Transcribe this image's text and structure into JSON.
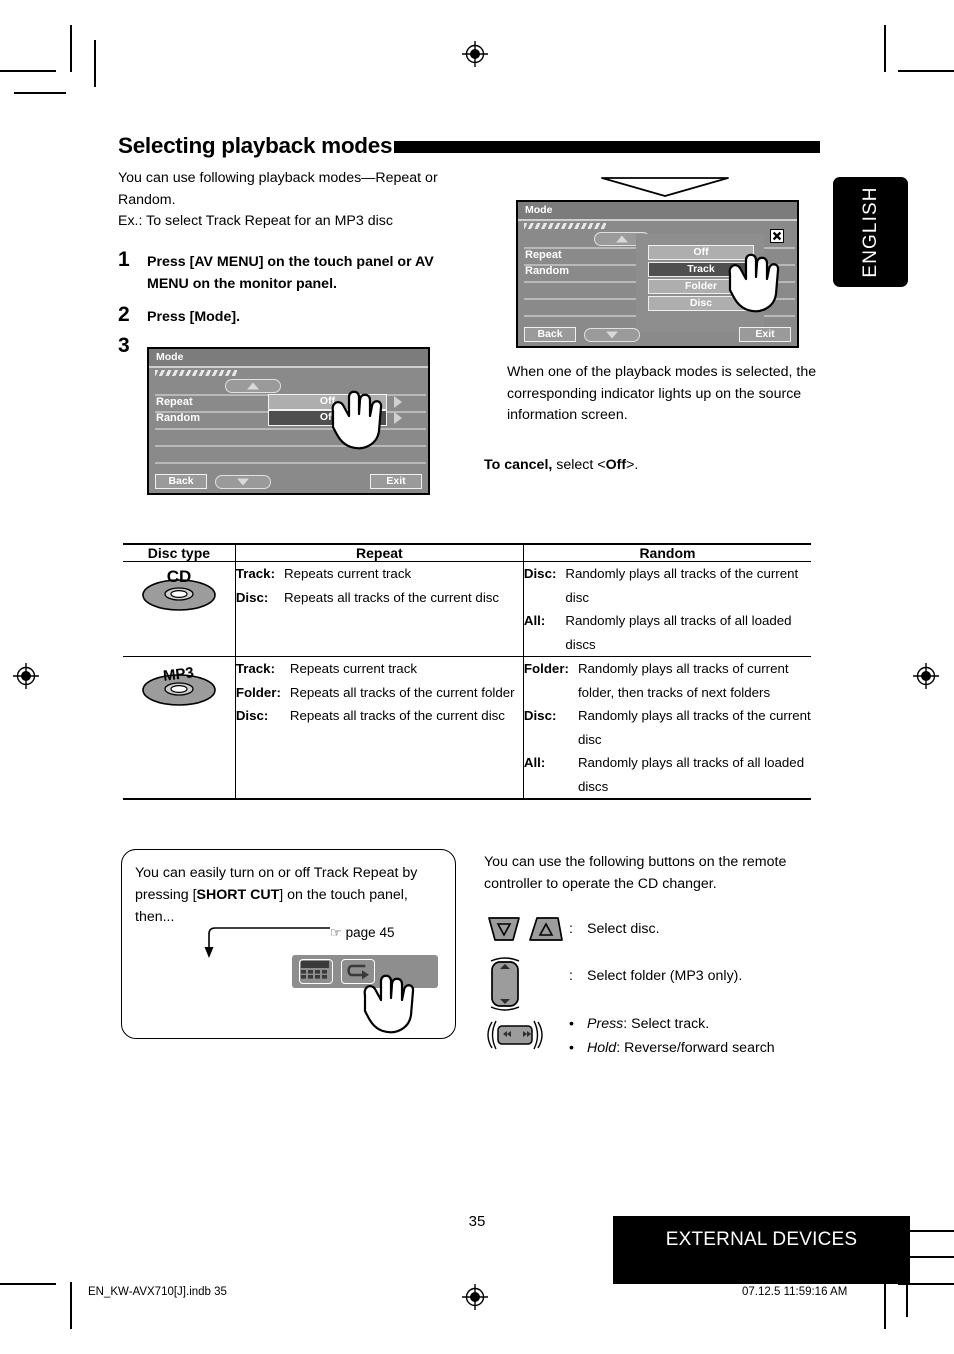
{
  "header": {
    "title": "Selecting playback modes"
  },
  "intro": {
    "line1": "You can use following playback modes—Repeat or",
    "line2": "Random.",
    "line3": "Ex.: To select Track Repeat for an MP3 disc"
  },
  "steps": [
    {
      "num": "1",
      "text": "Press [AV MENU] on the touch panel or AV MENU on the monitor panel."
    },
    {
      "num": "2",
      "text": "Press [Mode]."
    },
    {
      "num": "3",
      "text": ""
    }
  ],
  "screen_step3": {
    "title": "Mode",
    "rows": [
      {
        "label": "Repeat",
        "value": "Off",
        "highlight": "light"
      },
      {
        "label": "Random",
        "value": "Off",
        "highlight": "dark"
      }
    ],
    "back_label": "Back",
    "exit_label": "Exit"
  },
  "screen_popup": {
    "title": "Mode",
    "rows": [
      {
        "label": "Repeat"
      },
      {
        "label": "Random"
      }
    ],
    "popup_options": [
      {
        "label": "Off",
        "state": "normal"
      },
      {
        "label": "Track",
        "state": "selected"
      },
      {
        "label": "Folder",
        "state": "normal"
      },
      {
        "label": "Disc",
        "state": "normal"
      }
    ],
    "back_label": "Back",
    "exit_label": "Exit",
    "close_icon": "close-icon"
  },
  "right_notes": {
    "note": "When one of the playback modes is selected, the corresponding indicator lights up on the source information screen.",
    "cancel_bold": "To cancel,",
    "cancel_rest": " select <",
    "cancel_value": "Off",
    "cancel_end": ">."
  },
  "language_tab": {
    "label": "ENGLISH"
  },
  "table": {
    "headers": [
      "Disc type",
      "Repeat",
      "Random"
    ],
    "rows": [
      {
        "disc": "CD",
        "disc_icon": "cd-disc-icon",
        "repeat": [
          {
            "term": "Track:",
            "desc": "Repeats current track"
          },
          {
            "term": "Disc:",
            "desc": "Repeats all tracks of the current disc"
          }
        ],
        "random": [
          {
            "term": "Disc:",
            "desc": "Randomly plays all tracks of the current disc"
          },
          {
            "term": "All:",
            "desc": "Randomly plays all tracks of all loaded discs"
          }
        ]
      },
      {
        "disc": "MP3",
        "disc_icon": "mp3-disc-icon",
        "repeat": [
          {
            "term": "Track:",
            "desc": "Repeats current track"
          },
          {
            "term": "Folder:",
            "desc": "Repeats all tracks of the current folder"
          },
          {
            "term": "Disc:",
            "desc": "Repeats all tracks of the current disc"
          }
        ],
        "random": [
          {
            "term": "Folder:",
            "desc": "Randomly plays all tracks of current folder, then tracks of next folders"
          },
          {
            "term": "Disc:",
            "desc": "Randomly plays all tracks of the current disc"
          },
          {
            "term": "All:",
            "desc": "Randomly plays all tracks of all loaded discs"
          }
        ]
      }
    ]
  },
  "tipbox": {
    "text_a": "You can easily turn on or off Track Repeat by pressing [",
    "text_b": "SHORT CUT",
    "text_c": "] on the touch panel, then...",
    "page_ref": "page 45",
    "pointer_glyph": "☞",
    "buttons": [
      "keypad-icon",
      "repeat-loop-icon"
    ]
  },
  "remote": {
    "intro": "You can use the following buttons on the remote controller to operate the CD changer.",
    "items": [
      {
        "icon": "disc-down-up-buttons-icon",
        "colon": ":",
        "text": "Select disc."
      },
      {
        "icon": "folder-rocker-button-icon",
        "colon": ":",
        "text": "Select folder (MP3 only)."
      },
      {
        "icon": "track-seek-button-icon",
        "bullets": [
          {
            "em": "Press",
            "rest": ": Select track."
          },
          {
            "em": "Hold",
            "rest": ": Reverse/forward search"
          }
        ]
      }
    ]
  },
  "footer": {
    "page_number": "35",
    "section_badge": "EXTERNAL DEVICES",
    "file_name": "EN_KW-AVX710[J].indb   35",
    "timestamp": "07.12.5   11:59:16 AM"
  },
  "colors": {
    "black": "#000000",
    "screen_bg": "#8a8a8a",
    "screen_dark": "#4f4f4f",
    "screen_light": "#aeaeae"
  }
}
